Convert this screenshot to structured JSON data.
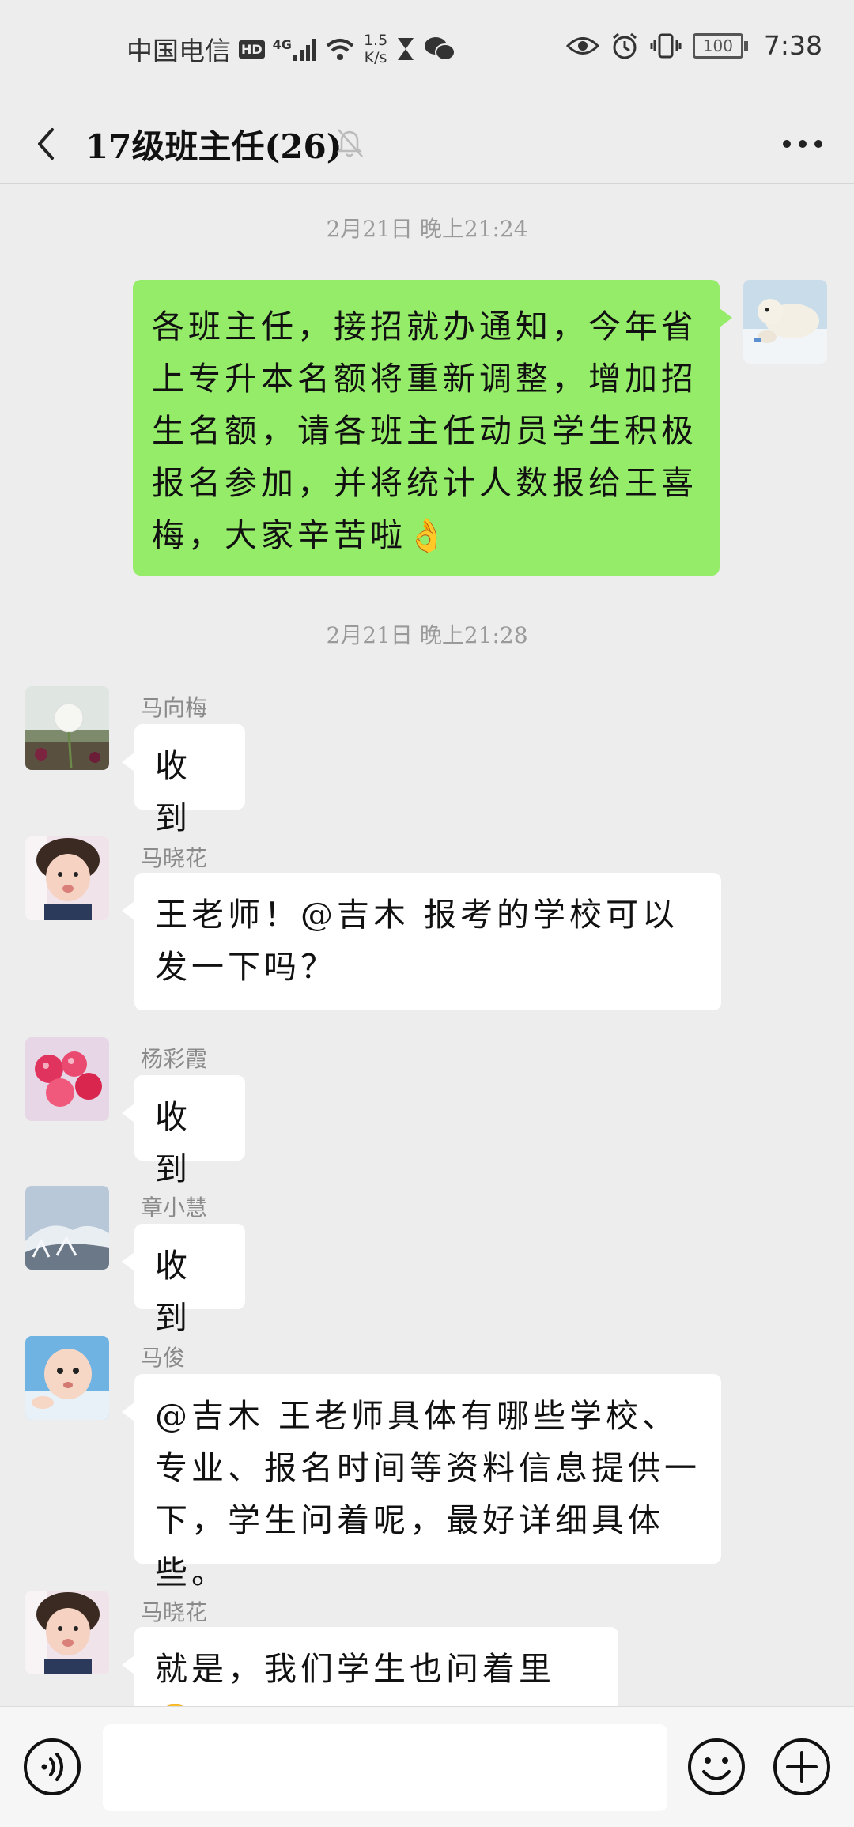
{
  "status_bar": {
    "carrier": "中国电信",
    "hd": "HD",
    "network": "4G",
    "speed_value": "1.5",
    "speed_unit": "K/s",
    "battery": "100",
    "time": "7:38"
  },
  "header": {
    "title": "17级班主任(26)"
  },
  "messages": [
    {
      "kind": "time",
      "text": "2月21日 晚上21:24"
    },
    {
      "kind": "self",
      "text": "各班主任，接招就办通知，今年省上专升本名额将重新调整，增加招生名额，请各班主任动员学生积极报名参加，并将统计人数报给王喜梅，大家辛苦啦👌"
    },
    {
      "kind": "time",
      "text": "2月21日 晚上21:28"
    },
    {
      "kind": "other",
      "sender": "马向梅",
      "text": "收到"
    },
    {
      "kind": "other",
      "sender": "马晓花",
      "text": "王老师！@吉木  报考的学校可以发一下吗？"
    },
    {
      "kind": "other",
      "sender": "杨彩霞",
      "text": "收到"
    },
    {
      "kind": "other",
      "sender": "章小慧",
      "text": "收到"
    },
    {
      "kind": "other",
      "sender": "马俊",
      "text": "@吉木  王老师具体有哪些学校、专业、报名时间等资料信息提供一下，学生问着呢，最好详细具体些。"
    },
    {
      "kind": "other",
      "sender": "马晓花",
      "text": "就是，我们学生也问着里😂"
    }
  ],
  "input": {
    "placeholder": ""
  },
  "colors": {
    "background": "#ededed",
    "self_bubble": "#95ec69",
    "other_bubble": "#ffffff"
  }
}
